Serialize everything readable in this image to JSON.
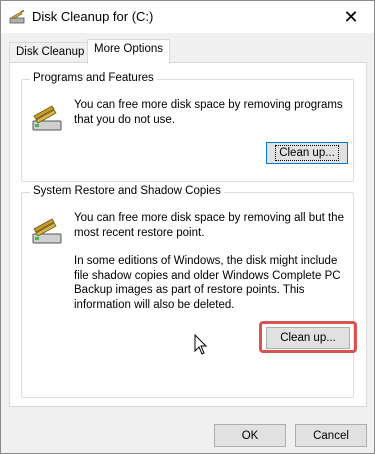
{
  "window": {
    "title": "Disk Cleanup for  (C:)"
  },
  "tabs": [
    {
      "label": "Disk Cleanup",
      "active": false
    },
    {
      "label": "More Options",
      "active": true
    }
  ],
  "programs_group": {
    "legend": "Programs and Features",
    "description": "You can free more disk space by removing programs that you do not use.",
    "button_label": "Clean up..."
  },
  "restore_group": {
    "legend": "System Restore and Shadow Copies",
    "description1": "You can free more disk space by removing all but the most recent restore point.",
    "description2": "In some editions of Windows, the disk might include file shadow copies and older Windows Complete PC Backup images as part of restore points. This information will also be deleted.",
    "button_label": "Clean up..."
  },
  "footer": {
    "ok_label": "OK",
    "cancel_label": "Cancel"
  },
  "colors": {
    "highlight": "#d9534f",
    "focus": "#0078d7"
  }
}
